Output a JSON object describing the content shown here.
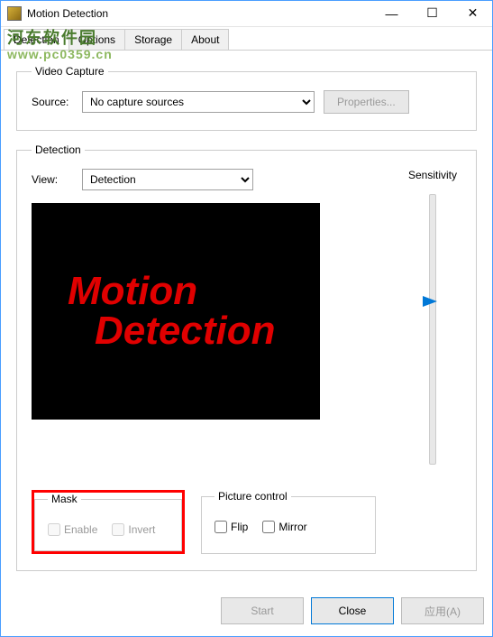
{
  "window": {
    "title": "Motion Detection"
  },
  "tabs": {
    "items": [
      "Detection",
      "Options",
      "Storage",
      "About"
    ],
    "active": 0
  },
  "watermark": {
    "line1": "河东软件园",
    "line2": "www.pc0359.cn"
  },
  "video_capture": {
    "legend": "Video Capture",
    "source_label": "Source:",
    "source_selected": "No capture sources",
    "properties_btn": "Properties..."
  },
  "detection": {
    "legend": "Detection",
    "view_label": "View:",
    "view_selected": "Detection",
    "sensitivity_label": "Sensitivity",
    "preview_line1": "Motion",
    "preview_line2": "Detection"
  },
  "mask": {
    "legend": "Mask",
    "enable": "Enable",
    "invert": "Invert"
  },
  "picture_control": {
    "legend": "Picture control",
    "flip": "Flip",
    "mirror": "Mirror"
  },
  "buttons": {
    "start": "Start",
    "close": "Close",
    "apply": "应用(A)"
  }
}
